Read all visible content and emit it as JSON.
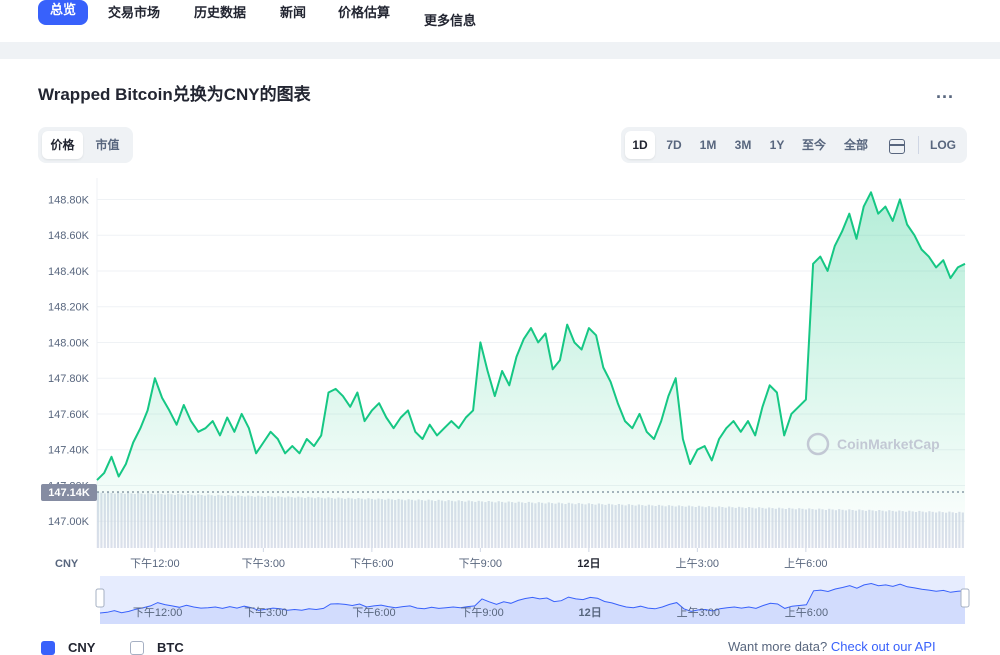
{
  "nav": {
    "items": [
      "总览",
      "交易市场",
      "历史数据",
      "新闻",
      "价格估算",
      "更多信息"
    ]
  },
  "chart_section": {
    "title": "Wrapped Bitcoin兑换为CNY的图表",
    "more": "...",
    "type_toggle": [
      "价格",
      "市值"
    ],
    "ranges": [
      "1D",
      "7D",
      "1M",
      "3M",
      "1Y",
      "至今",
      "全部"
    ],
    "log": "LOG",
    "calendar_icon": "calendar-icon"
  },
  "legend": {
    "cny": "CNY",
    "btc": "BTC",
    "api_prefix": "Want more data?",
    "api_link": "Check out our API"
  },
  "colors": {
    "accent": "#3861fb",
    "line": "#16c784",
    "volume": "#cfd6e4"
  },
  "chart_data": {
    "type": "area",
    "currency_label": "CNY",
    "watermark": "CoinMarketCap",
    "current_price_label": "147.14K",
    "y_ticks": [
      {
        "v": 147000,
        "label": "147.00K"
      },
      {
        "v": 147200,
        "label": "147.20K"
      },
      {
        "v": 147400,
        "label": "147.40K"
      },
      {
        "v": 147600,
        "label": "147.60K"
      },
      {
        "v": 147800,
        "label": "147.80K"
      },
      {
        "v": 148000,
        "label": "148.00K"
      },
      {
        "v": 148200,
        "label": "148.20K"
      },
      {
        "v": 148400,
        "label": "148.40K"
      },
      {
        "v": 148600,
        "label": "148.60K"
      },
      {
        "v": 148800,
        "label": "148.80K"
      }
    ],
    "x_ticks": [
      {
        "t": 12,
        "label": "下午12:00",
        "bold": false
      },
      {
        "t": 15,
        "label": "下午3:00",
        "bold": false
      },
      {
        "t": 18,
        "label": "下午6:00",
        "bold": false
      },
      {
        "t": 21,
        "label": "下午9:00",
        "bold": false
      },
      {
        "t": 24,
        "label": "12日",
        "bold": true
      },
      {
        "t": 27,
        "label": "上午3:00",
        "bold": false
      },
      {
        "t": 30,
        "label": "上午6:00",
        "bold": false
      }
    ],
    "x_range": [
      10.4,
      34.4
    ],
    "ylim": [
      146850,
      148920
    ],
    "series": [
      {
        "name": "CNY",
        "points": [
          [
            10.4,
            147230
          ],
          [
            10.6,
            147270
          ],
          [
            10.8,
            147360
          ],
          [
            11.0,
            147250
          ],
          [
            11.2,
            147320
          ],
          [
            11.4,
            147440
          ],
          [
            11.6,
            147520
          ],
          [
            11.8,
            147620
          ],
          [
            12.0,
            147800
          ],
          [
            12.2,
            147690
          ],
          [
            12.4,
            147620
          ],
          [
            12.6,
            147540
          ],
          [
            12.8,
            147650
          ],
          [
            13.0,
            147560
          ],
          [
            13.2,
            147500
          ],
          [
            13.4,
            147520
          ],
          [
            13.6,
            147560
          ],
          [
            13.8,
            147480
          ],
          [
            14.0,
            147580
          ],
          [
            14.2,
            147500
          ],
          [
            14.4,
            147600
          ],
          [
            14.6,
            147520
          ],
          [
            14.8,
            147380
          ],
          [
            15.0,
            147440
          ],
          [
            15.2,
            147500
          ],
          [
            15.4,
            147460
          ],
          [
            15.6,
            147380
          ],
          [
            15.8,
            147420
          ],
          [
            16.0,
            147380
          ],
          [
            16.2,
            147460
          ],
          [
            16.4,
            147420
          ],
          [
            16.6,
            147480
          ],
          [
            16.8,
            147720
          ],
          [
            17.0,
            147740
          ],
          [
            17.2,
            147700
          ],
          [
            17.4,
            147640
          ],
          [
            17.6,
            147720
          ],
          [
            17.8,
            147560
          ],
          [
            18.0,
            147620
          ],
          [
            18.2,
            147660
          ],
          [
            18.4,
            147580
          ],
          [
            18.6,
            147520
          ],
          [
            18.8,
            147580
          ],
          [
            19.0,
            147620
          ],
          [
            19.2,
            147500
          ],
          [
            19.4,
            147460
          ],
          [
            19.6,
            147540
          ],
          [
            19.8,
            147480
          ],
          [
            20.0,
            147520
          ],
          [
            20.2,
            147560
          ],
          [
            20.4,
            147520
          ],
          [
            20.6,
            147580
          ],
          [
            20.8,
            147620
          ],
          [
            21.0,
            148000
          ],
          [
            21.2,
            147840
          ],
          [
            21.4,
            147700
          ],
          [
            21.6,
            147840
          ],
          [
            21.8,
            147760
          ],
          [
            22.0,
            147920
          ],
          [
            22.2,
            148020
          ],
          [
            22.4,
            148080
          ],
          [
            22.6,
            148000
          ],
          [
            22.8,
            148050
          ],
          [
            23.0,
            147850
          ],
          [
            23.2,
            147900
          ],
          [
            23.4,
            148100
          ],
          [
            23.6,
            148000
          ],
          [
            23.8,
            147960
          ],
          [
            24.0,
            148080
          ],
          [
            24.2,
            148040
          ],
          [
            24.4,
            147860
          ],
          [
            24.6,
            147780
          ],
          [
            24.8,
            147660
          ],
          [
            25.0,
            147560
          ],
          [
            25.2,
            147520
          ],
          [
            25.4,
            147600
          ],
          [
            25.6,
            147500
          ],
          [
            25.8,
            147460
          ],
          [
            26.0,
            147560
          ],
          [
            26.2,
            147700
          ],
          [
            26.4,
            147800
          ],
          [
            26.6,
            147460
          ],
          [
            26.8,
            147320
          ],
          [
            27.0,
            147400
          ],
          [
            27.2,
            147420
          ],
          [
            27.4,
            147340
          ],
          [
            27.6,
            147460
          ],
          [
            27.8,
            147520
          ],
          [
            28.0,
            147560
          ],
          [
            28.2,
            147500
          ],
          [
            28.4,
            147560
          ],
          [
            28.6,
            147480
          ],
          [
            28.8,
            147640
          ],
          [
            29.0,
            147760
          ],
          [
            29.2,
            147720
          ],
          [
            29.4,
            147480
          ],
          [
            29.6,
            147600
          ],
          [
            29.8,
            147640
          ],
          [
            30.0,
            147680
          ],
          [
            30.2,
            148440
          ],
          [
            30.4,
            148480
          ],
          [
            30.6,
            148400
          ],
          [
            30.8,
            148540
          ],
          [
            31.0,
            148620
          ],
          [
            31.2,
            148720
          ],
          [
            31.4,
            148580
          ],
          [
            31.6,
            148760
          ],
          [
            31.8,
            148840
          ],
          [
            32.0,
            148720
          ],
          [
            32.2,
            148760
          ],
          [
            32.4,
            148680
          ],
          [
            32.6,
            148800
          ],
          [
            32.8,
            148660
          ],
          [
            33.0,
            148600
          ],
          [
            33.2,
            148520
          ],
          [
            33.4,
            148480
          ],
          [
            33.6,
            148420
          ],
          [
            33.8,
            148460
          ],
          [
            34.0,
            148360
          ],
          [
            34.2,
            148420
          ],
          [
            34.4,
            148440
          ]
        ]
      }
    ]
  }
}
